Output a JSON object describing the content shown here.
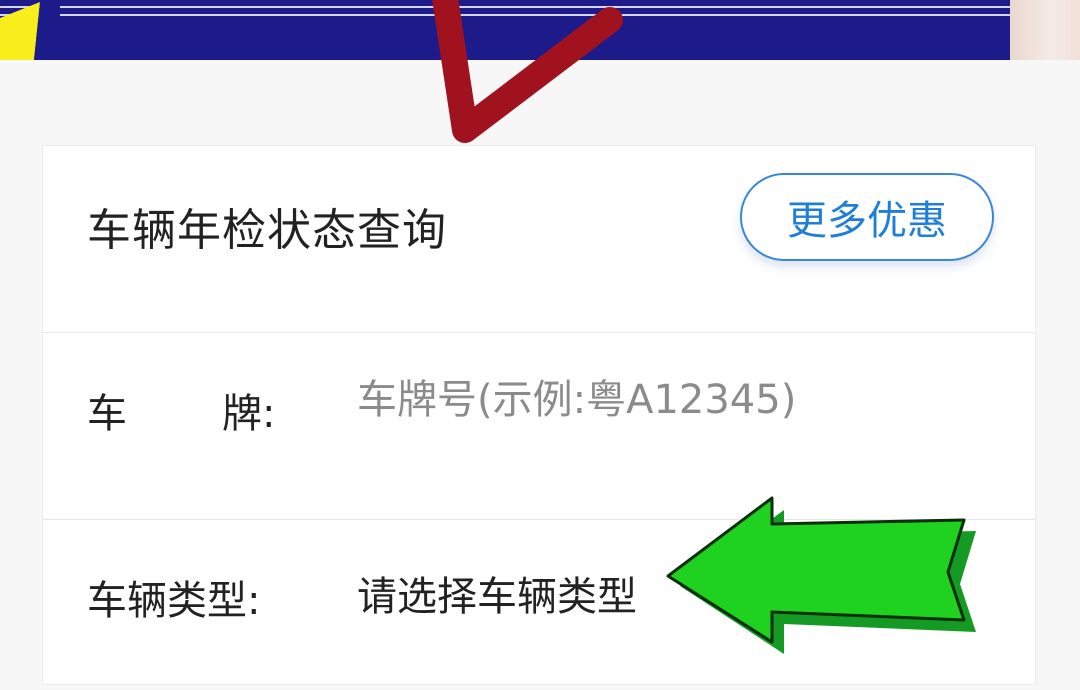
{
  "header": {
    "banner": "promo-banner",
    "title": "车辆年检状态查询",
    "more_button": "更多优惠"
  },
  "form": {
    "plate": {
      "label_char1": "车",
      "label_char2": "牌:",
      "placeholder": "车牌号(示例:粤A12345)"
    },
    "vehicle_type": {
      "label": "车辆类型:",
      "value": "请选择车辆类型"
    }
  },
  "colors": {
    "banner": "#1d1a8a",
    "accent": "#1f7ed8",
    "annotation_red": "#a0121e",
    "annotation_green": "#1fd21f"
  }
}
